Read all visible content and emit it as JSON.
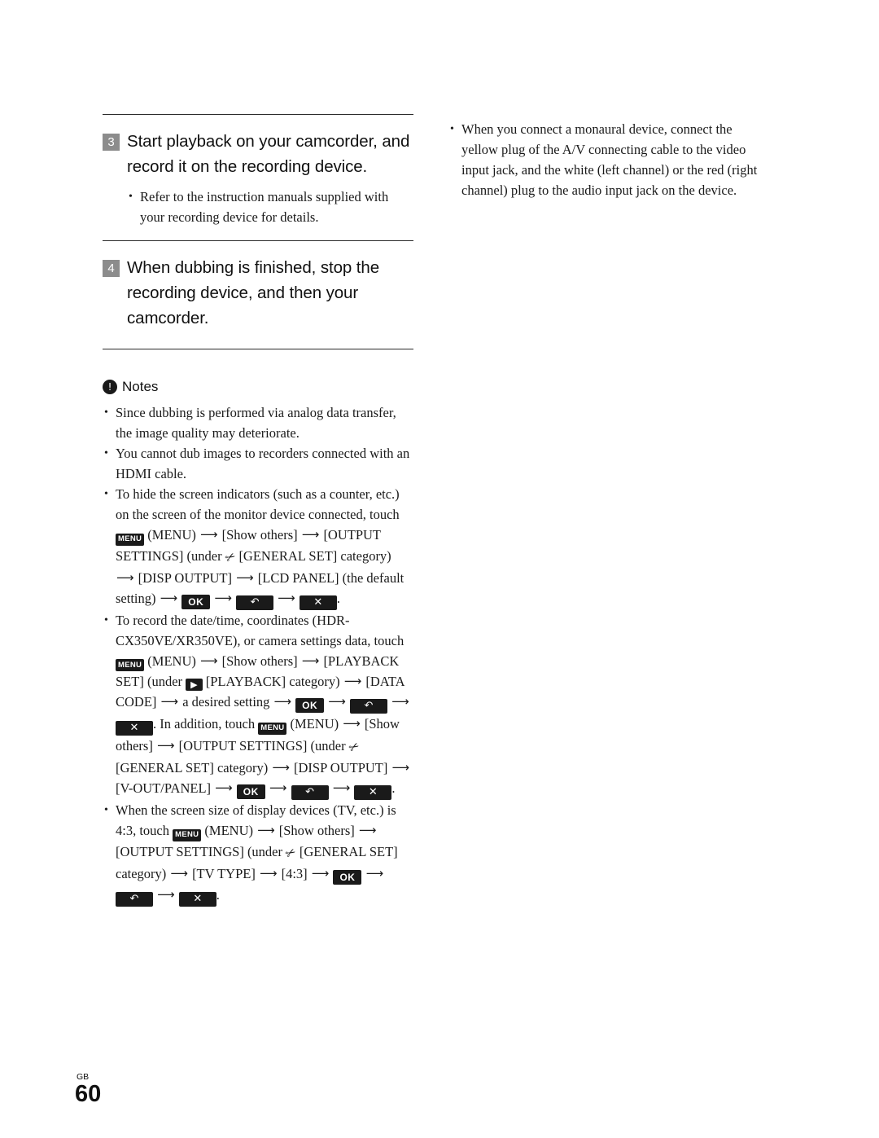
{
  "page": {
    "footer_locale": "GB",
    "footer_number": "60"
  },
  "left_column": {
    "steps": [
      {
        "number": "3",
        "title": "Start playback on your camcorder, and record it on the recording device.",
        "bullets": [
          "Refer to the instruction manuals supplied with your recording device for details."
        ]
      },
      {
        "number": "4",
        "title": "When dubbing is finished, stop the recording device, and then your camcorder.",
        "bullets": []
      }
    ],
    "notes": {
      "icon": "exclamation-icon",
      "label": "Notes",
      "items": {
        "n1": "Since dubbing is performed via analog data transfer, the image quality may deteriorate.",
        "n2": "You cannot dub images to recorders connected with an HDMI cable.",
        "n3_a": "To hide the screen indicators (such as a counter, etc.) on the screen of the monitor device connected, touch",
        "n3_b": "(MENU)",
        "n3_c": "[Show others]",
        "n3_d": "[OUTPUT SETTINGS] (under",
        "n3_e": "[GENERAL SET] category)",
        "n3_f": "[DISP OUTPUT]",
        "n3_g": "[LCD PANEL] (the default setting)",
        "n4_a": "To record the date/time, coordinates (HDR-CX350VE/XR350VE), or camera settings data, touch",
        "n4_b": "(MENU)",
        "n4_c": "[Show others]",
        "n4_d": "[PLAYBACK SET] (under",
        "n4_e": "[PLAYBACK] category)",
        "n4_f": "[DATA CODE]",
        "n4_g": "a desired setting",
        "n4_h": ". In addition, touch",
        "n4_i": "(MENU)",
        "n4_j": "[Show others]",
        "n4_k": "[OUTPUT SETTINGS] (under",
        "n4_l": "[GENERAL SET] category)",
        "n4_m": "[DISP OUTPUT]",
        "n4_n": "[V-OUT/PANEL]",
        "n5_a": "When the screen size of display devices (TV, etc.) is 4:3, touch",
        "n5_b": "(MENU)",
        "n5_c": "[Show others]",
        "n5_d": "[OUTPUT SETTINGS] (under",
        "n5_e": "[GENERAL SET] category)",
        "n5_f": "[TV TYPE]",
        "n5_g": "[4:3]"
      },
      "keys": {
        "menu": "MENU",
        "ok": "OK",
        "back": "back-arrow",
        "close": "close-x",
        "playback": "playback-icon",
        "wrench": "wrench-icon",
        "arrow": "→"
      }
    }
  },
  "right_column": {
    "bullets": [
      "When you connect a monaural device, connect the yellow plug of the A/V connecting cable to the video input jack, and the white (left channel) or the red (right channel) plug to the audio input jack on the device."
    ]
  }
}
